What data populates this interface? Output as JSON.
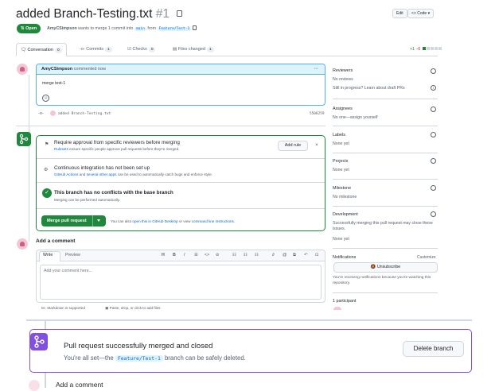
{
  "pr": {
    "title": "added Branch-Testing.txt",
    "number": "#1",
    "edit_label": "Edit",
    "code_label": "<> Code",
    "status": "Open",
    "author": "AmyCSimpson",
    "merge_text": "wants to merge 1 commit into",
    "base_branch": "main",
    "from_text": "from",
    "head_branch": "Feature/Test-1"
  },
  "tabs": [
    {
      "label": "Conversation",
      "count": "0"
    },
    {
      "label": "Commits",
      "count": "1"
    },
    {
      "label": "Checks",
      "count": "0"
    },
    {
      "label": "Files changed",
      "count": "1"
    }
  ],
  "diffstat": {
    "add": "+1",
    "del": "−0"
  },
  "comment": {
    "author": "AmyCSimpson",
    "when": "commented now",
    "body": "merge test-1",
    "more": "···"
  },
  "commit": {
    "message": "added Branch-Testing.txt",
    "sha": "5508259"
  },
  "merge": {
    "req_title": "Require approval from specific reviewers before merging",
    "req_link": "Rulesets",
    "req_sub": "ensure specific people approve pull requests before they're merged.",
    "add_rule": "Add rule",
    "ci_title": "Continuous integration has not been set up",
    "ci_link1": "GitHub Actions",
    "ci_and": "and",
    "ci_link2": "several other apps",
    "ci_sub": "can be used to automatically catch bugs and enforce style.",
    "conf_title": "This branch has no conflicts with the base branch",
    "conf_sub": "Merging can be performed automatically.",
    "merge_button": "Merge pull request",
    "also_text": "You can also",
    "also_link1": "open this in GitHub Desktop",
    "also_or": "or view",
    "also_link2": "command line instructions",
    "also_end": "."
  },
  "add_comment": {
    "heading": "Add a comment",
    "write": "Write",
    "preview": "Preview",
    "placeholder": "Add your comment here...",
    "markdown": "Markdown is supported",
    "paste": "Paste, drop, or click to add files"
  },
  "sidebar": {
    "reviewers": {
      "label": "Reviewers",
      "value": "No reviews",
      "extra": "Still in progress? Learn about draft PRs"
    },
    "assignees": {
      "label": "Assignees",
      "value": "No one—assign yourself"
    },
    "labels": {
      "label": "Labels",
      "value": "None yet"
    },
    "projects": {
      "label": "Projects",
      "value": "None yet"
    },
    "milestone": {
      "label": "Milestone",
      "value": "No milestone"
    },
    "development": {
      "label": "Development",
      "value": "Successfully merging this pull request may close these issues.",
      "extra": "None yet"
    },
    "notifications": {
      "label": "Notifications",
      "customize": "Customize",
      "button": "Unsubscribe",
      "note": "You're receiving notifications because you're watching this repository."
    },
    "participants": {
      "label": "1 participant"
    }
  },
  "banner": {
    "title": "Pull request successfully merged and closed",
    "pre": "You're all set—the",
    "branch": "Feature/Test-1",
    "post": "branch can be safely deleted.",
    "button": "Delete branch"
  },
  "footer": {
    "add_comment": "Add a comment"
  },
  "colors": {
    "green": "#1f883d",
    "purple": "#8250df",
    "blue": "#0969da"
  }
}
